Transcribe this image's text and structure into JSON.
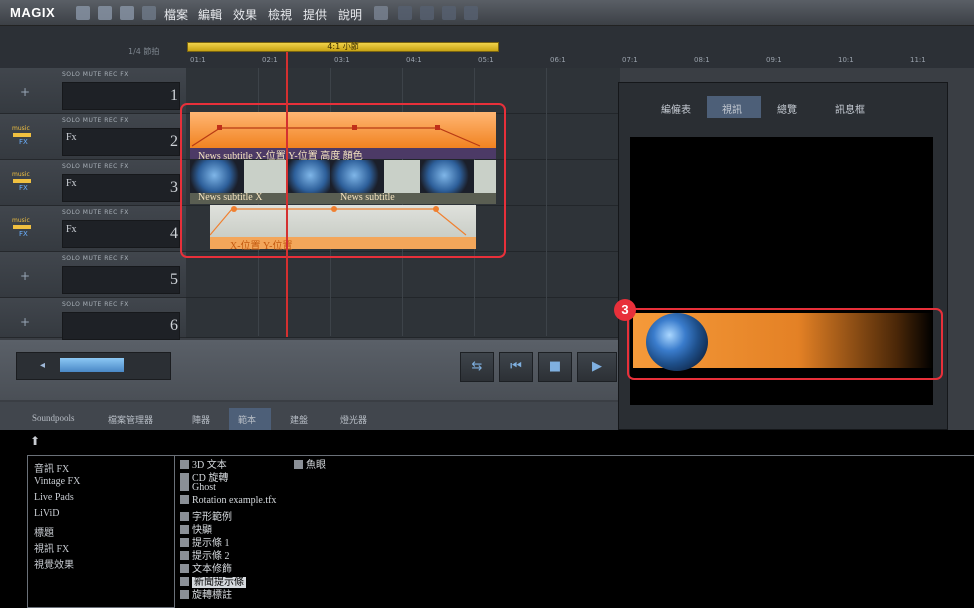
{
  "app": {
    "logo": "MAGIX"
  },
  "menu": [
    "檔案",
    "編輯",
    "效果",
    "檢視",
    "提供",
    "說明"
  ],
  "ruler": {
    "zoom_label": "1/4 節拍",
    "range_label": "4:1 小節",
    "ticks": [
      "01:1",
      "02:1",
      "03:1",
      "04:1",
      "05:1",
      "06:1",
      "07:1",
      "08:1",
      "09:1",
      "10:1",
      "11:1"
    ]
  },
  "track_buttons": "SOLO  MUTE    REC     FX",
  "tracks": [
    {
      "number": "1",
      "name": ""
    },
    {
      "number": "2",
      "name": "Fx"
    },
    {
      "number": "3",
      "name": "Fx"
    },
    {
      "number": "4",
      "name": "Fx"
    },
    {
      "number": "5",
      "name": ""
    },
    {
      "number": "6",
      "name": ""
    }
  ],
  "clips": {
    "track2_text": "News subtitle  X-位置  Y-位置  高度  顏色",
    "track3_text1": "News subtitle  X",
    "track3_text2": "News subtitle",
    "track4_text": "X-位置  Y-位置"
  },
  "preview": {
    "tabs": [
      "編僱表",
      "視訊",
      "總覽",
      "訊息框"
    ],
    "active_tab": "視訊",
    "step_badge": "3"
  },
  "transport": {
    "loop": "⇆",
    "prev": "⏮",
    "stop": "■",
    "play": "▶"
  },
  "lower_tabs": [
    "Soundpools",
    "檔案管理器",
    "陣器",
    "範本",
    "建盤",
    "燈光器"
  ],
  "active_lower_tab": "範本",
  "categories": [
    "音訊 FX",
    "Vintage FX",
    "Live Pads",
    "LiViD",
    "標題",
    "視訊 FX",
    "視覺效果"
  ],
  "files_col1": [
    "3D 文本",
    "CD 旋轉",
    "Ghost",
    "Rotation example.tfx",
    "字形範例",
    "快顯",
    "提示條 1",
    "提示條 2",
    "文本修飾",
    "新聞提示條",
    "旋轉標註"
  ],
  "files_col2": [
    "魚眼"
  ],
  "selected_file": "新聞提示條",
  "colors": {
    "accent_red": "#e8303a",
    "clip_orange": "#f0801c",
    "active_tab": "#4d5f78"
  }
}
